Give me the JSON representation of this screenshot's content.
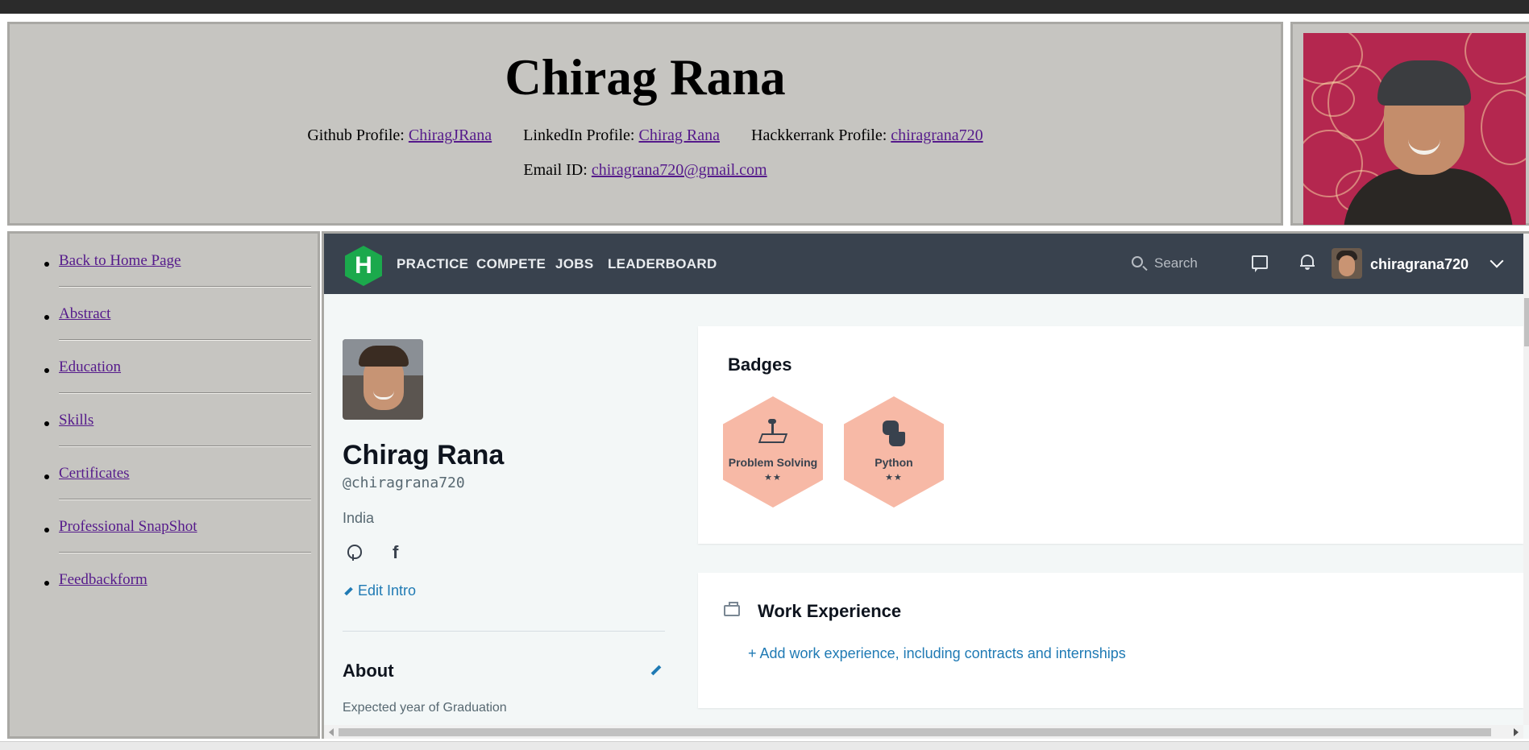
{
  "header": {
    "title": "Chirag Rana",
    "github_label": "Github Profile:",
    "github_link": "ChiragJRana",
    "linkedin_label": "LinkedIn Profile:",
    "linkedin_link": "Chirag Rana",
    "hackerrank_label": "Hackkerrank Profile:",
    "hackerrank_link": "chiragrana720",
    "email_label": "Email ID:",
    "email_link": "chiragrana720@gmail.com"
  },
  "sidebar": {
    "items": [
      {
        "label": "Back to Home Page"
      },
      {
        "label": "Abstract"
      },
      {
        "label": "Education"
      },
      {
        "label": "Skills"
      },
      {
        "label": "Certificates"
      },
      {
        "label": "Professional SnapShot"
      },
      {
        "label": "Feedbackform"
      }
    ]
  },
  "hackerrank": {
    "logo_letter": "H",
    "nav": {
      "practice": "PRACTICE",
      "compete": "COMPETE",
      "jobs": "JOBS",
      "leaderboard": "LEADERBOARD",
      "search_placeholder": "Search",
      "username": "chiragrana720"
    },
    "profile": {
      "name": "Chirag Rana",
      "handle": "@chiragrana720",
      "country": "India",
      "facebook_glyph": "f",
      "edit_intro": "Edit Intro",
      "about_title": "About",
      "about_sub": "Expected year of Graduation"
    },
    "badges": {
      "title": "Badges",
      "items": [
        {
          "label": "Problem Solving",
          "stars": "★★",
          "rating": 2
        },
        {
          "label": "Python",
          "stars": "★★",
          "rating": 2
        }
      ]
    },
    "work": {
      "title": "Work Experience",
      "add_link": "+ Add work experience, including contracts and internships"
    }
  },
  "colors": {
    "frame_bg": "#c6c5c1",
    "link_visited": "#551a8b",
    "hr_nav_bg": "#39424e",
    "hr_green": "#1ba94c",
    "hr_link": "#1f7ab4",
    "badge_bg": "#f7b9a6"
  }
}
